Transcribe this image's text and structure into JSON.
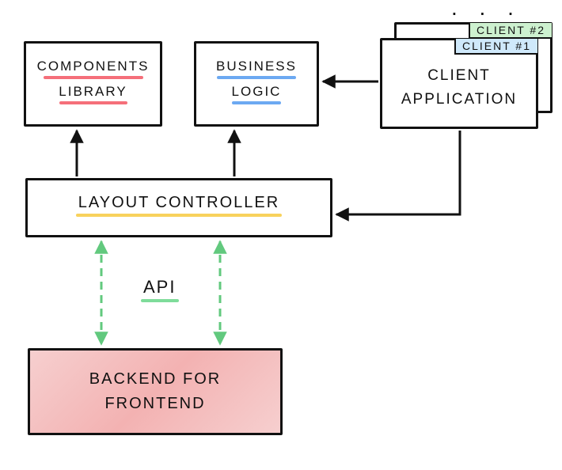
{
  "boxes": {
    "components": {
      "line1": "COMPONENTS",
      "line2": "LIBRARY",
      "underline_color": "red"
    },
    "business": {
      "line1": "BUSINESS",
      "line2": "LOGIC",
      "underline_color": "blue"
    },
    "client": {
      "tag": "CLIENT #1",
      "line1": "CLIENT",
      "line2": "APPLICATION"
    },
    "client2": {
      "tag": "CLIENT #2"
    },
    "layout": {
      "label": "LAYOUT CONTROLLER",
      "underline_color": "yellow"
    },
    "bff": {
      "line1": "BACKEND FOR",
      "line2": "FRONTEND"
    }
  },
  "api": {
    "label": "API",
    "underline_color": "green"
  },
  "ellipsis": ". . .",
  "arrows": [
    {
      "from": "layout",
      "to": "components",
      "style": "solid"
    },
    {
      "from": "layout",
      "to": "business",
      "style": "solid"
    },
    {
      "from": "client",
      "to": "business",
      "style": "solid"
    },
    {
      "from": "client",
      "to": "layout",
      "style": "solid",
      "path": "down-then-left"
    },
    {
      "from": "layout",
      "to": "bff",
      "style": "dashed-green",
      "bidirectional": true
    },
    {
      "from": "layout",
      "to": "bff",
      "style": "dashed-green",
      "bidirectional": true
    }
  ]
}
